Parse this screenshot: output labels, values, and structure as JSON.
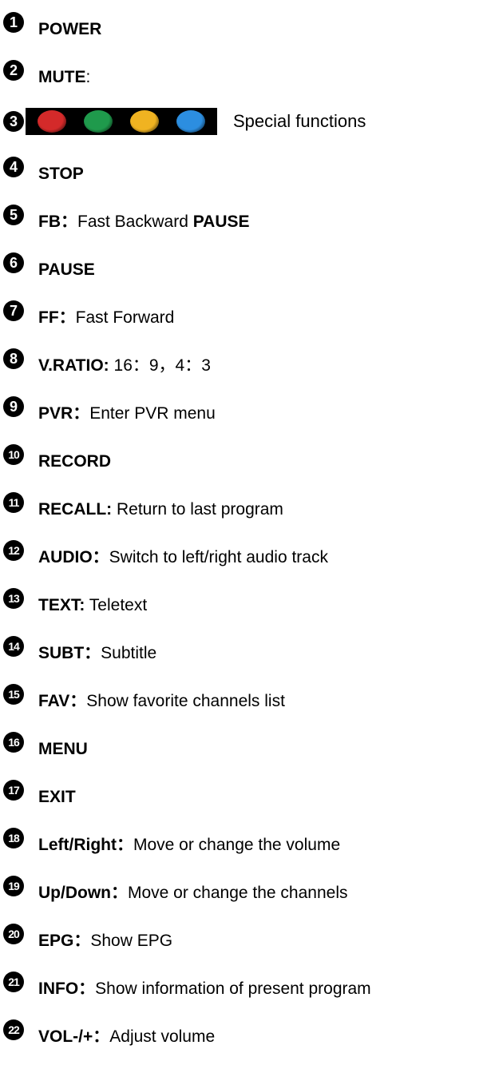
{
  "items": [
    {
      "n": "1",
      "key": "POWER",
      "sep": "",
      "desc": "",
      "tail": ""
    },
    {
      "n": "2",
      "key": "MUTE",
      "sep": ":",
      "desc": "",
      "tail": ""
    },
    {
      "n": "3",
      "special_label": "Special functions",
      "colors": [
        "#d42a2a",
        "#1f9a4c",
        "#f0b321",
        "#2c8ee0"
      ]
    },
    {
      "n": "4",
      "key": "STOP",
      "sep": "",
      "desc": "",
      "tail": ""
    },
    {
      "n": "5",
      "key": "FB",
      "sep": "：",
      "desc": "Fast Backward ",
      "tail": "PAUSE"
    },
    {
      "n": "6",
      "key": "PAUSE",
      "sep": "",
      "desc": "",
      "tail": ""
    },
    {
      "n": "7",
      "key": "FF",
      "sep": "：",
      "desc": "Fast Forward",
      "tail": ""
    },
    {
      "n": "8",
      "key": "V.RATIO:",
      "sep": "",
      "desc": " 16：9，4：3",
      "tail": ""
    },
    {
      "n": "9",
      "key": "PVR",
      "sep": "：",
      "desc": "Enter PVR menu",
      "tail": ""
    },
    {
      "n": "10",
      "key": "RECORD",
      "sep": "",
      "desc": "",
      "tail": ""
    },
    {
      "n": "11",
      "key": "RECALL:",
      "sep": "",
      "desc": " Return to last program",
      "tail": ""
    },
    {
      "n": "12",
      "key": "AUDIO",
      "sep": "：",
      "desc": "Switch to left/right audio track",
      "tail": ""
    },
    {
      "n": "13",
      "key": "TEXT:",
      "sep": "",
      "desc": " Teletext",
      "tail": ""
    },
    {
      "n": "14",
      "key": "SUBT",
      "sep": "：",
      "desc": "Subtitle",
      "tail": ""
    },
    {
      "n": "15",
      "key": "FAV",
      "sep": "：",
      "desc": "Show favorite channels list",
      "tail": ""
    },
    {
      "n": "16",
      "key": "MENU",
      "sep": "",
      "desc": "",
      "tail": ""
    },
    {
      "n": "17",
      "key": "EXIT",
      "sep": "",
      "desc": "",
      "tail": ""
    },
    {
      "n": "18",
      "key": "Left/Right",
      "sep": "：",
      "desc": "Move or change the volume",
      "tail": ""
    },
    {
      "n": "19",
      "key": "Up/Down",
      "sep": "：",
      "desc": "Move or change the channels",
      "tail": ""
    },
    {
      "n": "20",
      "key": "EPG",
      "sep": "：",
      "desc": "Show EPG",
      "tail": ""
    },
    {
      "n": "21",
      "key": "INFO",
      "sep": "：",
      "desc": "Show information of present program",
      "tail": ""
    },
    {
      "n": "22",
      "key": "VOL-/+",
      "sep": "：",
      "desc": "Adjust volume",
      "tail": ""
    }
  ]
}
